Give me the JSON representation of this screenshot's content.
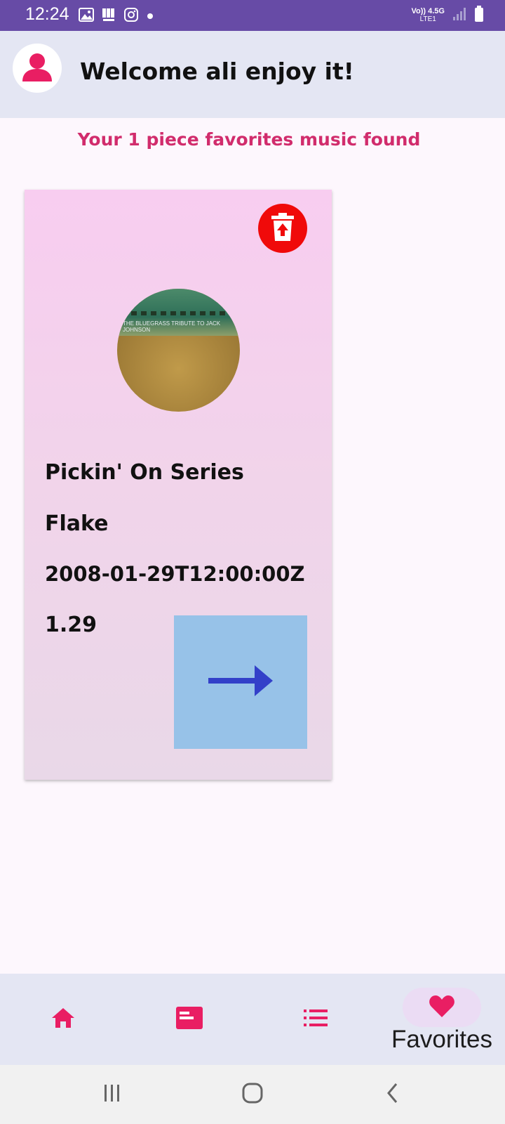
{
  "status_bar": {
    "time": "12:24",
    "network_top": "Vo)) 4.5G",
    "network_bottom": "LTE1"
  },
  "header": {
    "welcome_text": "Welcome ali enjoy it!",
    "avatar_icon": "person-icon"
  },
  "main": {
    "found_text": "Your 1 piece favorites music found",
    "favorites": [
      {
        "album_art_text": "THE BLUEGRASS TRIBUTE TO JACK JOHNSON",
        "collection": "Pickin' On Series",
        "track": "Flake",
        "release_date": "2008-01-29T12:00:00Z",
        "price": "1.29",
        "delete_icon": "trash-icon",
        "open_icon": "arrow-right-icon"
      }
    ]
  },
  "bottom_nav": {
    "items": [
      {
        "icon": "home-icon"
      },
      {
        "icon": "news-icon"
      },
      {
        "icon": "list-icon"
      },
      {
        "icon": "heart-icon",
        "label": "Favorites",
        "selected": true
      }
    ]
  },
  "colors": {
    "status_bar": "#674ba6",
    "accent": "#e91e63",
    "delete": "#f00a0a",
    "go_button": "#97c2e8",
    "arrow": "#3340c9"
  }
}
